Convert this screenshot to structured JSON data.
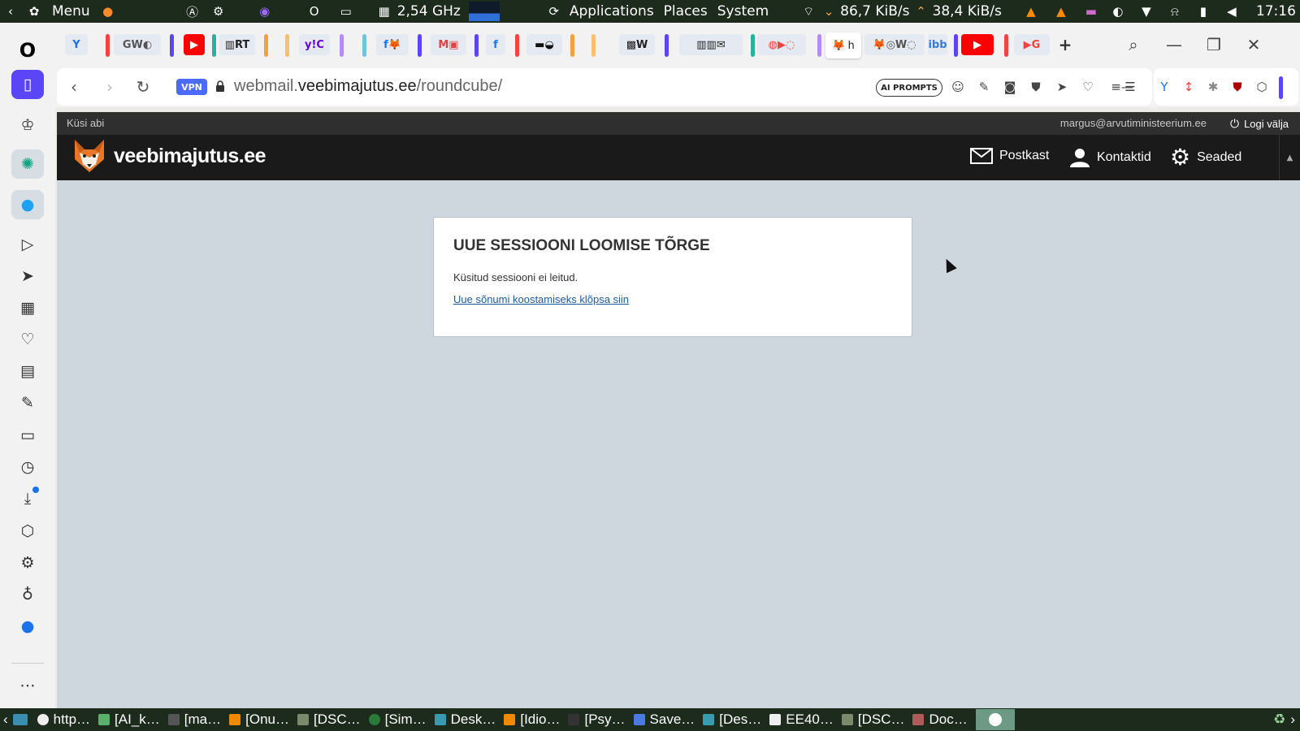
{
  "system_panel": {
    "menu_label": "Menu",
    "cpu_freq": "2,54 GHz",
    "applications": "Applications",
    "places": "Places",
    "system": "System",
    "net_down": "86,7 KiB/s",
    "net_up": "38,4 KiB/s",
    "clock": "17:16"
  },
  "browser": {
    "vpn_label": "VPN",
    "url_host_prefix": "webmail.",
    "url_domain": "veebimajutus.ee",
    "url_path": "/roundcube/",
    "ai_prompts_label": "AI PROMPTS",
    "active_tab_text": "h"
  },
  "roundcube": {
    "help_link": "Küsi abi",
    "user_email": "margus@arvutiministeerium.ee",
    "logout_label": "Logi välja",
    "logo_text": "veebimajutus.ee",
    "nav": {
      "mail": "Postkast",
      "contacts": "Kontaktid",
      "settings": "Seaded"
    },
    "error_box": {
      "title": "UUE SESSIOONI LOOMISE TÕRGE",
      "message": "Küsitud sessiooni ei leitud.",
      "link": "Uue sõnumi koostamiseks klõpsa siin"
    }
  },
  "taskbar": {
    "items": [
      "http…",
      "[AI_k…",
      "[ma…",
      "[Onu…",
      "[DSC…",
      "[Sim…",
      "Desk…",
      "[Idio…",
      "[Psy…",
      "Save…",
      "[Des…",
      "EE40…",
      "[DSC…",
      "Doc…"
    ]
  },
  "colors": {
    "panel_bg": "#1d2b1c",
    "page_bg": "#ced6de",
    "rc_header": "#1a1a1a",
    "link": "#1c5a9e",
    "vpn": "#4b6bfb"
  }
}
